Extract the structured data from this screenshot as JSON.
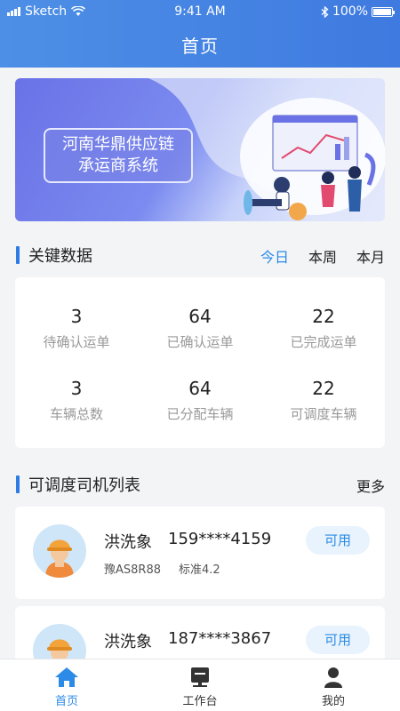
{
  "status_bar": {
    "carrier": "Sketch",
    "time": "9:41 AM",
    "battery": "100%"
  },
  "header": {
    "title": "首页"
  },
  "banner": {
    "line1": "河南华鼎供应链",
    "line2": "承运商系统"
  },
  "key_data": {
    "title": "关键数据",
    "tabs": [
      {
        "label": "今日",
        "active": true
      },
      {
        "label": "本周"
      },
      {
        "label": "本月"
      }
    ],
    "stats": [
      {
        "value": "3",
        "label": "待确认运单"
      },
      {
        "value": "64",
        "label": "已确认运单"
      },
      {
        "value": "22",
        "label": "已完成运单"
      },
      {
        "value": "3",
        "label": "车辆总数"
      },
      {
        "value": "64",
        "label": "已分配车辆"
      },
      {
        "value": "22",
        "label": "可调度车辆"
      }
    ]
  },
  "drivers": {
    "title": "可调度司机列表",
    "more": "更多",
    "items": [
      {
        "name": "洪洗象",
        "phone": "159****4159",
        "plate": "豫AS8R88",
        "type": "标准4.2",
        "status": "可用"
      },
      {
        "name": "洪洗象",
        "phone": "187****3867",
        "plate": "",
        "type": "",
        "status": "可用"
      }
    ]
  },
  "tabbar": {
    "items": [
      {
        "label": "首页",
        "icon": "home-icon",
        "active": true
      },
      {
        "label": "工作台",
        "icon": "workbench-icon"
      },
      {
        "label": "我的",
        "icon": "profile-icon"
      }
    ]
  },
  "colors": {
    "accent": "#2b8be6",
    "header": "#4286e3",
    "badge_bg": "#e8f3fd"
  }
}
